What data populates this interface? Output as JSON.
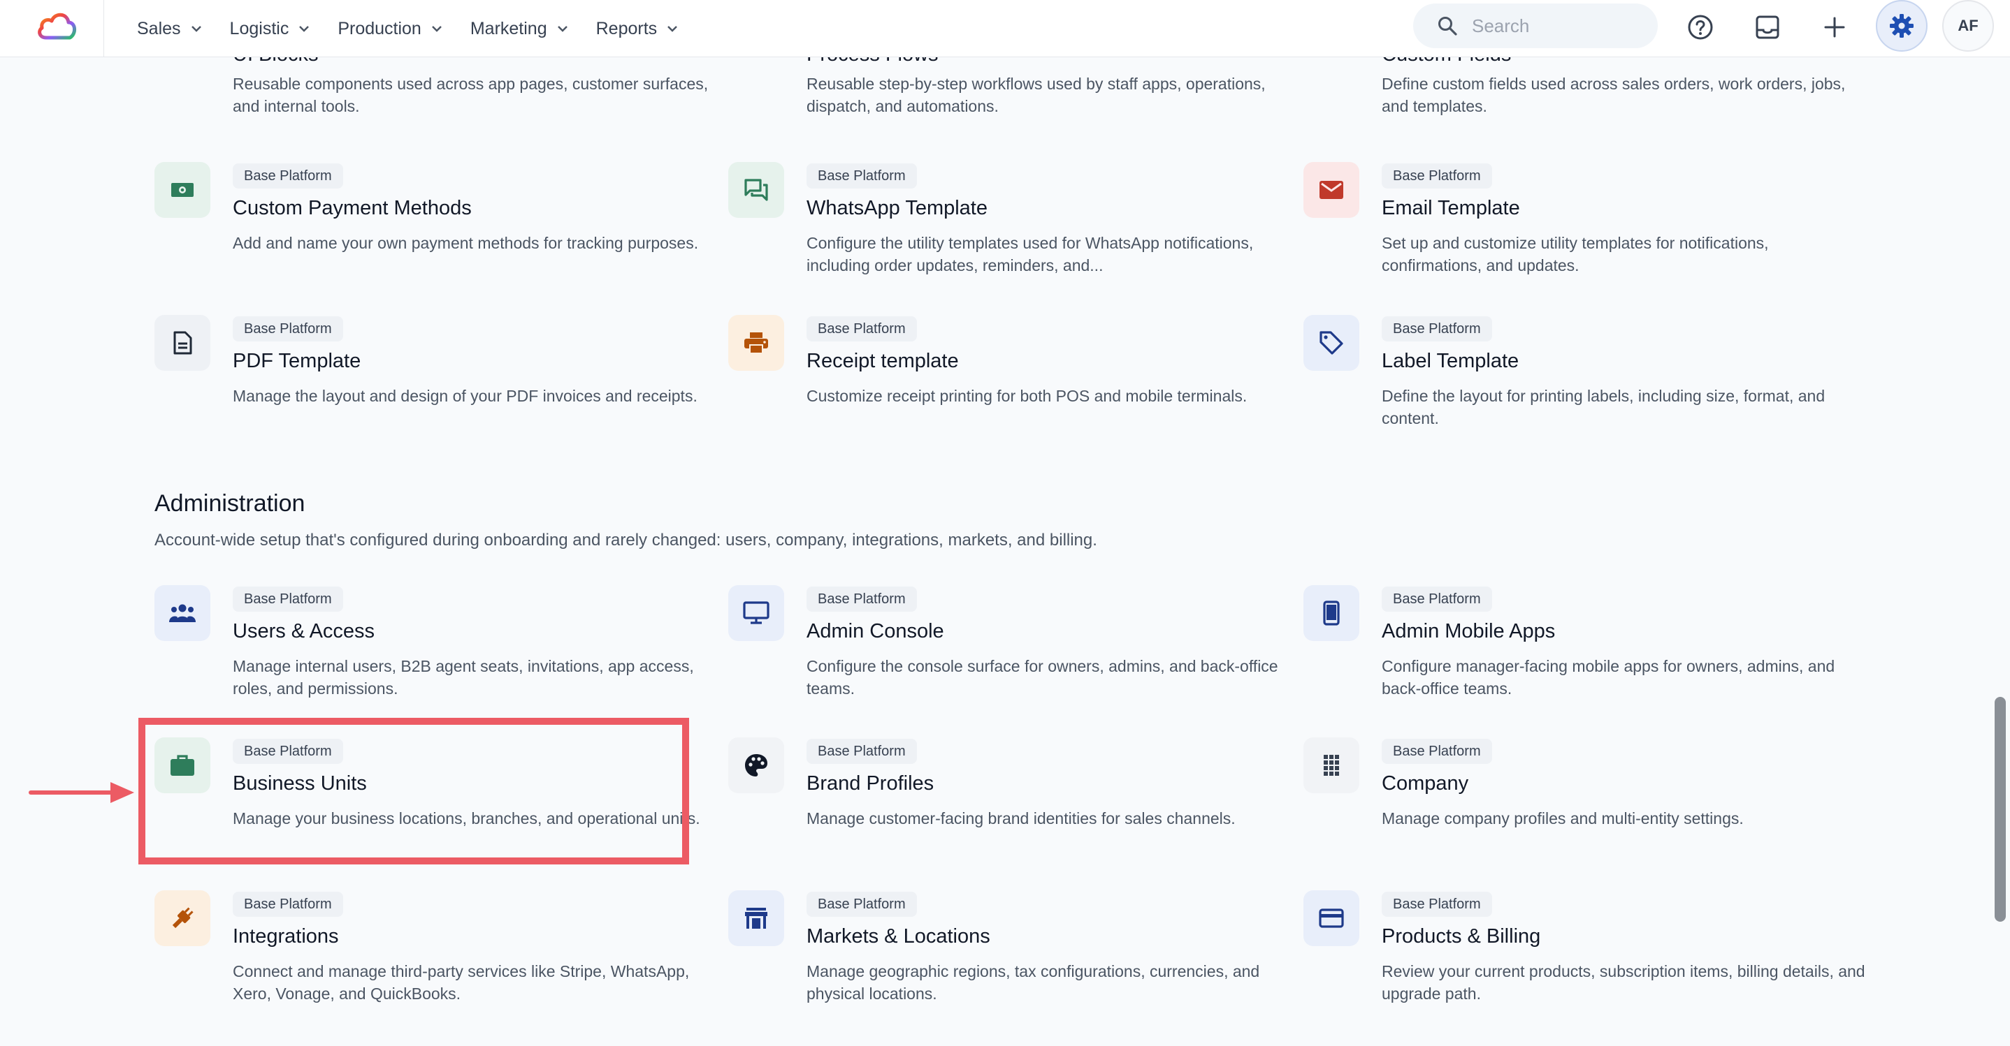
{
  "nav": {
    "items": [
      {
        "label": "Sales"
      },
      {
        "label": "Logistic"
      },
      {
        "label": "Production"
      },
      {
        "label": "Marketing"
      },
      {
        "label": "Reports"
      }
    ],
    "search_placeholder": "Search",
    "avatar_initials": "AF"
  },
  "top_cards": [
    {
      "title": "UI Blocks",
      "desc": "Reusable components used across app pages, customer surfaces, and internal tools."
    },
    {
      "title": "Process Flows",
      "desc": "Reusable step-by-step workflows used by staff apps, operations, dispatch, and automations."
    },
    {
      "title": "Custom Fields",
      "desc": "Define custom fields used across sales orders, work orders, jobs, and templates."
    }
  ],
  "templates": [
    {
      "badge": "Base Platform",
      "title": "Custom Payment Methods",
      "desc": "Add and name your own payment methods for tracking purposes.",
      "icon": "cash-icon"
    },
    {
      "badge": "Base Platform",
      "title": "WhatsApp Template",
      "desc": "Configure the utility templates used for WhatsApp notifications, including order updates, reminders, and...",
      "icon": "chat-icon"
    },
    {
      "badge": "Base Platform",
      "title": "Email Template",
      "desc": "Set up and customize utility templates for notifications, confirmations, and updates.",
      "icon": "mail-icon"
    },
    {
      "badge": "Base Platform",
      "title": "PDF Template",
      "desc": "Manage the layout and design of your PDF invoices and receipts.",
      "icon": "document-icon"
    },
    {
      "badge": "Base Platform",
      "title": "Receipt template",
      "desc": "Customize receipt printing for both POS and mobile terminals.",
      "icon": "printer-icon"
    },
    {
      "badge": "Base Platform",
      "title": "Label Template",
      "desc": "Define the layout for printing labels, including size, format, and content.",
      "icon": "tag-icon"
    }
  ],
  "administration": {
    "title": "Administration",
    "desc": "Account-wide setup that's configured during onboarding and rarely changed: users, company, integrations, markets, and billing.",
    "cards": [
      {
        "badge": "Base Platform",
        "title": "Users & Access",
        "desc": "Manage internal users, B2B agent seats, invitations, app access, roles, and permissions.",
        "icon": "users-icon"
      },
      {
        "badge": "Base Platform",
        "title": "Admin Console",
        "desc": "Configure the console surface for owners, admins, and back-office teams.",
        "icon": "monitor-icon"
      },
      {
        "badge": "Base Platform",
        "title": "Admin Mobile Apps",
        "desc": "Configure manager-facing mobile apps for owners, admins, and back-office teams.",
        "icon": "phone-icon"
      },
      {
        "badge": "Base Platform",
        "title": "Business Units",
        "desc": "Manage your business locations, branches, and operational units.",
        "icon": "briefcase-icon"
      },
      {
        "badge": "Base Platform",
        "title": "Brand Profiles",
        "desc": "Manage customer-facing brand identities for sales channels.",
        "icon": "palette-icon"
      },
      {
        "badge": "Base Platform",
        "title": "Company",
        "desc": "Manage company profiles and multi-entity settings.",
        "icon": "building-icon"
      },
      {
        "badge": "Base Platform",
        "title": "Integrations",
        "desc": "Connect and manage third-party services like Stripe, WhatsApp, Xero, Vonage, and QuickBooks.",
        "icon": "plug-icon"
      },
      {
        "badge": "Base Platform",
        "title": "Markets & Locations",
        "desc": "Manage geographic regions, tax configurations, currencies, and physical locations.",
        "icon": "store-icon"
      },
      {
        "badge": "Base Platform",
        "title": "Products & Billing",
        "desc": "Review your current products, subscription items, billing details, and upgrade path.",
        "icon": "credit-card-icon"
      }
    ]
  },
  "colors": {
    "accent": "#2563eb",
    "highlight": "#ec5b64",
    "green_icon": "#2e7d5b",
    "red_icon": "#c0392b",
    "orange_icon": "#b45309",
    "blue_icon": "#1e3a8a"
  }
}
